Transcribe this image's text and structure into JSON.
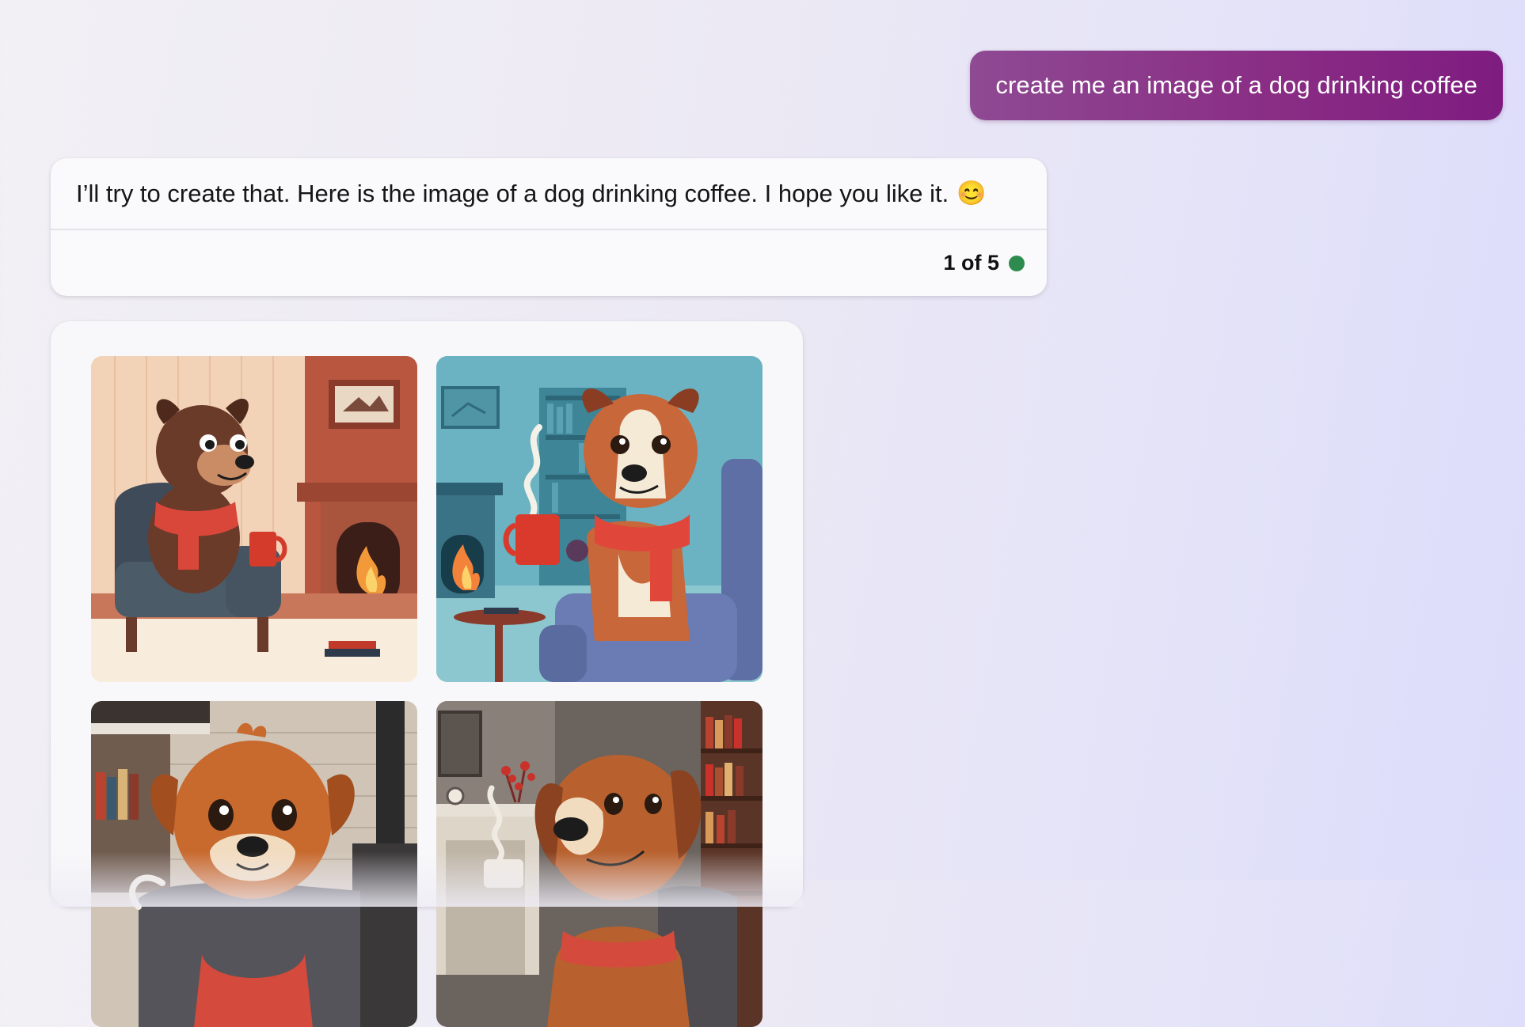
{
  "user_message": {
    "text": "create me an image of a dog drinking coffee"
  },
  "assistant_reply": {
    "text": "I’ll try to create that. Here is the image of a dog drinking coffee. I hope you like it.",
    "emoji": "😊",
    "counter": "1 of 5",
    "status_color": "#2e8b4e"
  },
  "images": [
    {
      "icon": "dog-fireplace-armchair-image"
    },
    {
      "icon": "dog-teal-room-mug-image"
    },
    {
      "icon": "dog-brick-stove-image"
    },
    {
      "icon": "dog-bookshelf-coffee-image"
    }
  ],
  "colors": {
    "user_bubble": "#8a2e85",
    "card_background": "#fafafc",
    "page_background": "#eceaf5"
  }
}
